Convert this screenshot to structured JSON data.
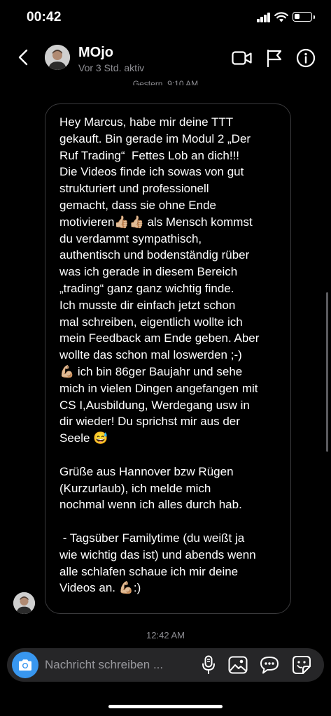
{
  "status_bar": {
    "time": "00:42"
  },
  "header": {
    "contact_name": "MOjo",
    "contact_status": "Vor 3 Std. aktiv",
    "icons": [
      "back-arrow-icon",
      "video-call-icon",
      "flag-icon",
      "info-icon"
    ]
  },
  "conversation": {
    "top_date": "Gestern, 9:10 AM",
    "message": "Hey Marcus, habe mir deine TTT\ngekauft. Bin gerade im Modul 2 „Der\nRuf Trading“  Fettes Lob an dich!!!\nDie Videos finde ich sowas von gut\nstrukturiert und professionell\ngemacht, dass sie ohne Ende\nmotivieren👍🏼👍🏼 als Mensch kommst\ndu verdammt sympathisch,\nauthentisch und bodenständig rüber\nwas ich gerade in diesem Bereich\n„trading“ ganz ganz wichtig finde.\nIch musste dir einfach jetzt schon\nmal schreiben, eigentlich wollte ich\nmein Feedback am Ende geben. Aber\nwollte das schon mal loswerden ;-)\n💪🏼 ich bin 86ger Baujahr und sehe\nmich in vielen Dingen angefangen mit\nCS I,Ausbildung, Werdegang usw in\ndir wieder! Du sprichst mir aus der\nSeele 😅\n\nGrüße aus Hannover bzw Rügen\n(Kurzurlaub), ich melde mich\nnochmal wenn ich alles durch hab.\n\n - Tagsüber Familytime (du weißt ja\nwie wichtig das ist) und abends wenn\nalle schlafen schaue ich mir deine\nVideos an. 💪🏼:)",
    "timestamp": "12:42 AM"
  },
  "composer": {
    "placeholder": "Nachricht schreiben ...",
    "icons": [
      "camera-icon",
      "microphone-icon",
      "gallery-icon",
      "chat-bubble-icon",
      "sticker-icon"
    ]
  },
  "colors": {
    "accent": "#3897f0",
    "bubble_border": "#3a3a3c",
    "muted_text": "#8e8e93",
    "composer_bg": "#262628"
  }
}
